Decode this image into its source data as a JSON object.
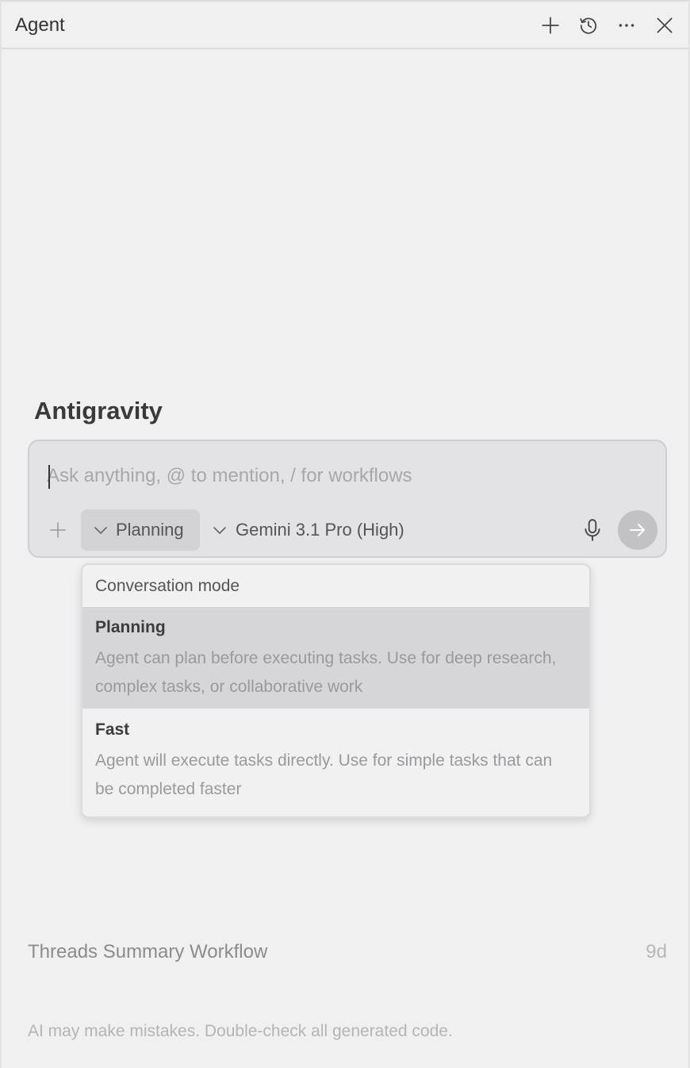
{
  "header": {
    "title": "Agent",
    "actions": [
      {
        "name": "new-chat",
        "icon": "plus-icon"
      },
      {
        "name": "history",
        "icon": "history-icon"
      },
      {
        "name": "more",
        "icon": "more-horizontal-icon"
      },
      {
        "name": "close",
        "icon": "close-icon"
      }
    ]
  },
  "brand": {
    "title": "Antigravity"
  },
  "composer": {
    "placeholder": "Ask anything, @ to mention, / for workflows",
    "value": "",
    "mode_label": "Planning",
    "model_label": "Gemini 3.1 Pro (High)",
    "icons": {
      "attach": "plus-icon",
      "mic": "microphone-icon",
      "send": "arrow-right-icon"
    }
  },
  "mode_dropdown": {
    "header": "Conversation mode",
    "options": [
      {
        "title": "Planning",
        "description": "Agent can plan before executing tasks. Use for deep research, complex tasks, or collaborative work",
        "selected": true
      },
      {
        "title": "Fast",
        "description": "Agent will execute tasks directly. Use for simple tasks that can be completed faster",
        "selected": false
      }
    ]
  },
  "threads": [
    {
      "title": "Threads Summary Workflow",
      "age": "9d"
    }
  ],
  "footer": {
    "disclaimer": "AI may make mistakes. Double-check all generated code."
  },
  "colors": {
    "background": "#f0f0f0",
    "composer_bg": "#e3e3e5",
    "selected_option": "#d6d6d9",
    "send_button": "#c2c2c5"
  }
}
